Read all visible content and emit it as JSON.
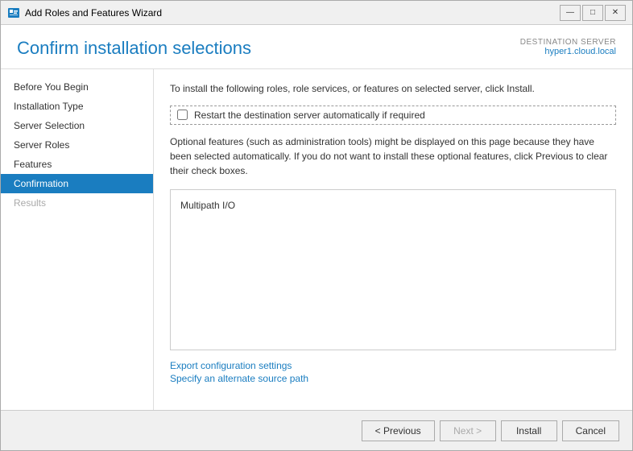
{
  "window": {
    "title": "Add Roles and Features Wizard",
    "controls": {
      "minimize": "—",
      "maximize": "□",
      "close": "✕"
    }
  },
  "header": {
    "title": "Confirm installation selections",
    "destination_server_label": "DESTINATION SERVER",
    "destination_server_name": "hyper1.cloud.local"
  },
  "sidebar": {
    "items": [
      {
        "label": "Before You Begin",
        "state": "normal"
      },
      {
        "label": "Installation Type",
        "state": "normal"
      },
      {
        "label": "Server Selection",
        "state": "normal"
      },
      {
        "label": "Server Roles",
        "state": "normal"
      },
      {
        "label": "Features",
        "state": "normal"
      },
      {
        "label": "Confirmation",
        "state": "active"
      },
      {
        "label": "Results",
        "state": "disabled"
      }
    ]
  },
  "main": {
    "intro_text": "To install the following roles, role services, or features on selected server, click Install.",
    "checkbox_label": "Restart the destination server automatically if required",
    "optional_text": "Optional features (such as administration tools) might be displayed on this page because they have been selected automatically. If you do not want to install these optional features, click Previous to clear their check boxes.",
    "features": [
      "Multipath I/O"
    ],
    "links": [
      {
        "label": "Export configuration settings"
      },
      {
        "label": "Specify an alternate source path"
      }
    ]
  },
  "footer": {
    "previous_label": "< Previous",
    "next_label": "Next >",
    "install_label": "Install",
    "cancel_label": "Cancel"
  }
}
